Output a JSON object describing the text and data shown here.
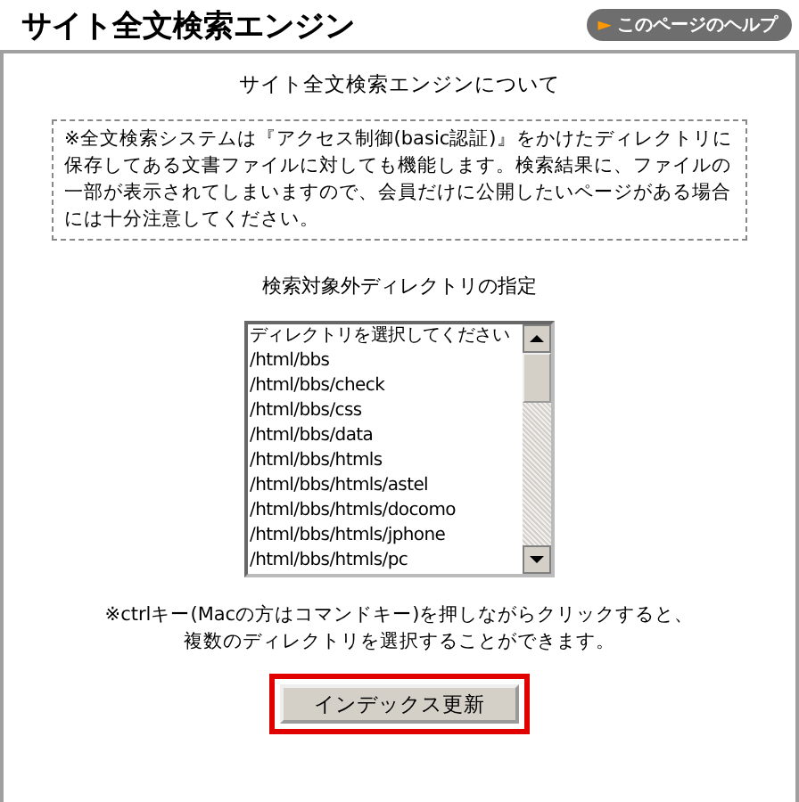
{
  "title": "サイト全文検索エンジン",
  "help_link": {
    "icon": "►",
    "label": "このページのヘルプ"
  },
  "section_heading": "サイト全文検索エンジンについて",
  "notice": "※全文検索システムは『アクセス制御(basic認証)』をかけたディレクトリに保存してある文書ファイルに対しても機能します。検索結果に、ファイルの一部が表示されてしまいますので、会員だけに公開したいページがある場合には十分注意してください。",
  "exclude_heading": "検索対象外ディレクトリの指定",
  "directory_list": {
    "items": [
      {
        "label": "ディレクトリを選択してください",
        "selected": false
      },
      {
        "label": "/html/bbs",
        "selected": false
      },
      {
        "label": "/html/bbs/check",
        "selected": false
      },
      {
        "label": "/html/bbs/css",
        "selected": false
      },
      {
        "label": "/html/bbs/data",
        "selected": false
      },
      {
        "label": "/html/bbs/htmls",
        "selected": false
      },
      {
        "label": "/html/bbs/htmls/astel",
        "selected": false
      },
      {
        "label": "/html/bbs/htmls/docomo",
        "selected": false
      },
      {
        "label": "/html/bbs/htmls/jphone",
        "selected": false
      },
      {
        "label": "/html/bbs/htmls/pc",
        "selected": false
      }
    ]
  },
  "hint_lines": [
    "※ctrlキー(Macの方はコマンドキー)を押しながらクリックすると、",
    "複数のディレクトリを選択することができます。"
  ],
  "update_button": {
    "label": "インデックス更新",
    "highlighted": true
  }
}
